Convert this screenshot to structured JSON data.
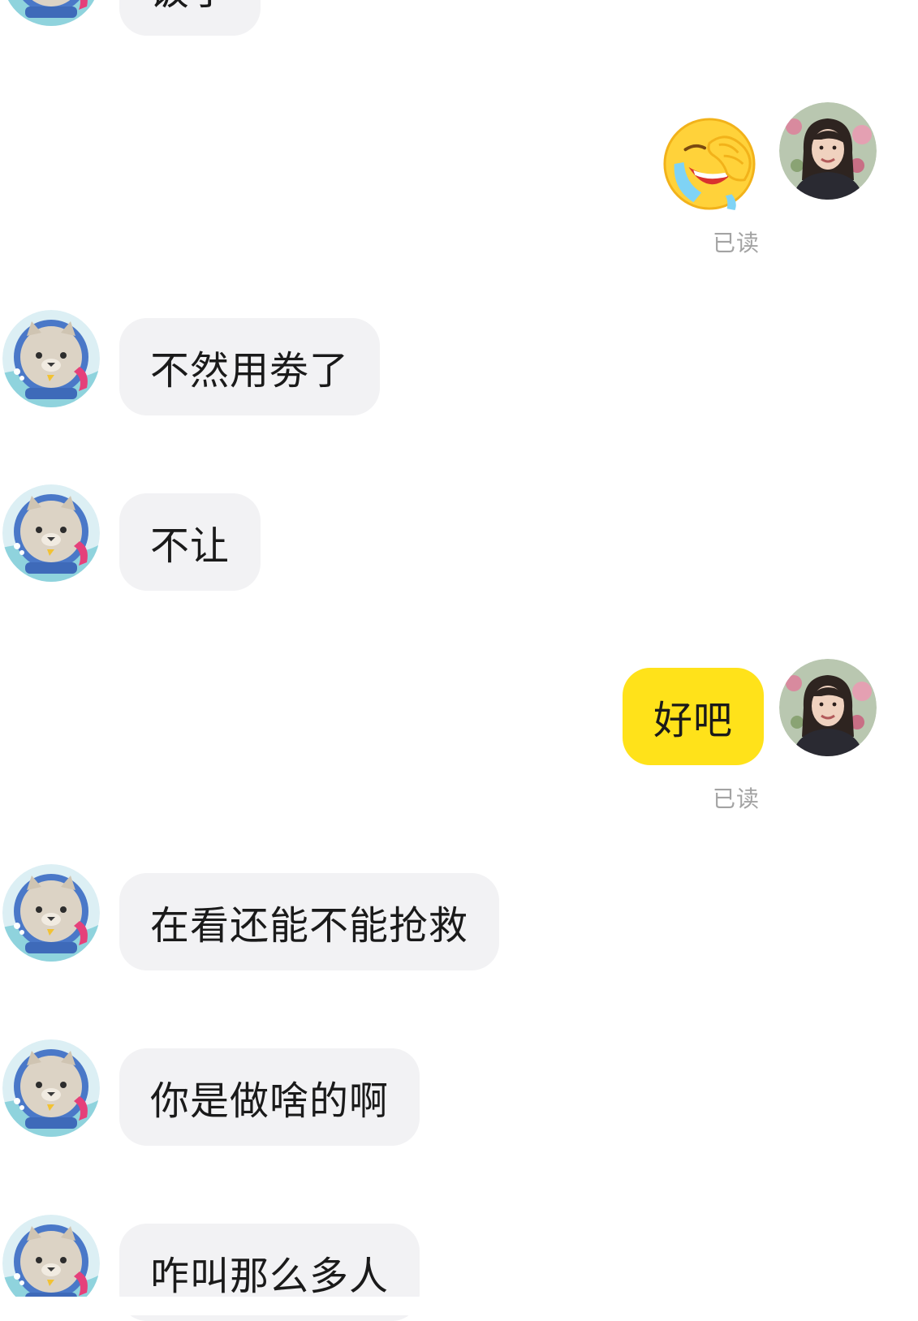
{
  "messages": [
    {
      "side": "in",
      "text": "饭了"
    },
    {
      "side": "out",
      "kind": "emoji",
      "emoji": "crying-laughing-facepalm-emoji",
      "status": "已读"
    },
    {
      "side": "in",
      "text": "不然用劵了"
    },
    {
      "side": "in",
      "text": "不让"
    },
    {
      "side": "out",
      "text": "好吧",
      "status": "已读"
    },
    {
      "side": "in",
      "text": "在看还能不能抢救"
    },
    {
      "side": "in",
      "text": "你是做啥的啊"
    },
    {
      "side": "in",
      "text": "咋叫那么多人"
    }
  ],
  "avatars": {
    "contact": "cat-astronaut-avatar",
    "self": "woman-photo-avatar"
  },
  "colors": {
    "incoming_bubble": "#f2f2f4",
    "outgoing_bubble": "#ffe21a",
    "read_status": "#a3a3a3",
    "text": "#1a1a1a"
  }
}
